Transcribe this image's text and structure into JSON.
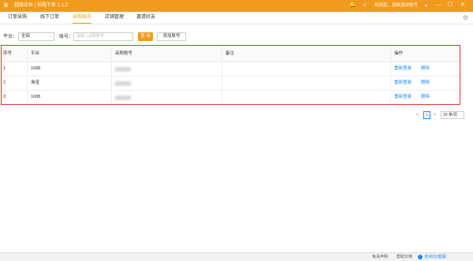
{
  "titlebar": {
    "app_title": "超级店长 | 采购下单 1.1.2",
    "user_text": "欢迎您，您帐测试帐号"
  },
  "tabs": [
    {
      "label": "订单采购"
    },
    {
      "label": "线下订单"
    },
    {
      "label": "采购账号"
    },
    {
      "label": "店铺管理"
    },
    {
      "label": "邀请好友"
    }
  ],
  "toolbar": {
    "platform_label": "平台：",
    "platform_value": "全部",
    "account_label": "账号：",
    "account_placeholder": "请输入采购账号",
    "query_label": "查 询",
    "add_label": "添加账号"
  },
  "table": {
    "headers": [
      "序号",
      "平台",
      "采购账号",
      "备注",
      "操作"
    ],
    "rows": [
      {
        "index": "1",
        "platform": "1688",
        "account": "",
        "note": "",
        "relogin": "重新登录",
        "delete": "删除"
      },
      {
        "index": "2",
        "platform": "淘宝",
        "account": "",
        "note": "",
        "relogin": "重新登录",
        "delete": "删除"
      },
      {
        "index": "3",
        "platform": "1688",
        "account": "",
        "note": "",
        "relogin": "重新登录",
        "delete": "删除"
      }
    ]
  },
  "pagination": {
    "prev": "<",
    "current": "1",
    "next": ">",
    "page_size": "10 条/页"
  },
  "statusbar": {
    "disclaimer": "免责声明",
    "help": "帮助文档",
    "qq": "咨询QQ客服"
  },
  "colors": {
    "accent": "#f29a1f",
    "link": "#1a8cff",
    "highlight_border": "#e23333"
  }
}
